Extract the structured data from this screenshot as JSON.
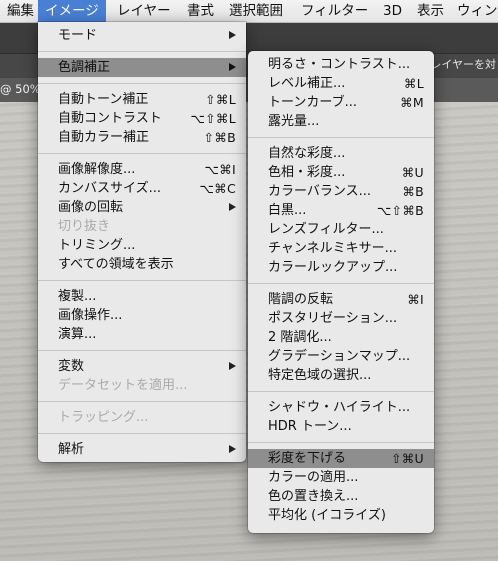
{
  "menubar": {
    "items": [
      "編集",
      "イメージ",
      "レイヤー",
      "書式",
      "選択範囲",
      "フィルター",
      "3D",
      "表示",
      "ウィン"
    ]
  },
  "tabbar": {
    "right_text": "にレイヤーを対"
  },
  "doc": {
    "zoom": "@ 50%"
  },
  "image_menu": {
    "mode": "モード",
    "adjust": "色調補正",
    "auto_tone": "自動トーン補正",
    "auto_tone_sc": "⇧⌘L",
    "auto_contrast": "自動コントラスト",
    "auto_contrast_sc": "⌥⇧⌘L",
    "auto_color": "自動カラー補正",
    "auto_color_sc": "⇧⌘B",
    "image_size": "画像解像度...",
    "image_size_sc": "⌥⌘I",
    "canvas_size": "カンバスサイズ...",
    "canvas_size_sc": "⌥⌘C",
    "rotate": "画像の回転",
    "crop": "切り抜き",
    "trim": "トリミング...",
    "reveal_all": "すべての領域を表示",
    "duplicate": "複製...",
    "apply_image": "画像操作...",
    "calculations": "演算...",
    "variables": "変数",
    "apply_dataset": "データセットを適用...",
    "trap": "トラッピング...",
    "analysis": "解析"
  },
  "adjust_menu": {
    "brightness": "明るさ・コントラスト...",
    "levels": "レベル補正...",
    "levels_sc": "⌘L",
    "curves": "トーンカーブ...",
    "curves_sc": "⌘M",
    "exposure": "露光量...",
    "vibrance": "自然な彩度...",
    "hue_sat": "色相・彩度...",
    "hue_sat_sc": "⌘U",
    "color_balance": "カラーバランス...",
    "color_balance_sc": "⌘B",
    "bw": "白黒...",
    "bw_sc": "⌥⇧⌘B",
    "photo_filter": "レンズフィルター...",
    "channel_mixer": "チャンネルミキサー...",
    "color_lookup": "カラールックアップ...",
    "invert": "階調の反転",
    "invert_sc": "⌘I",
    "posterize": "ポスタリゼーション...",
    "threshold": "2 階調化...",
    "gradient_map": "グラデーションマップ...",
    "selective_color": "特定色域の選択...",
    "shadows_highlights": "シャドウ・ハイライト...",
    "hdr_toning": "HDR トーン...",
    "desaturate": "彩度を下げる",
    "desaturate_sc": "⇧⌘U",
    "match_color": "カラーの適用...",
    "replace_color": "色の置き換え...",
    "equalize": "平均化 (イコライズ)"
  }
}
